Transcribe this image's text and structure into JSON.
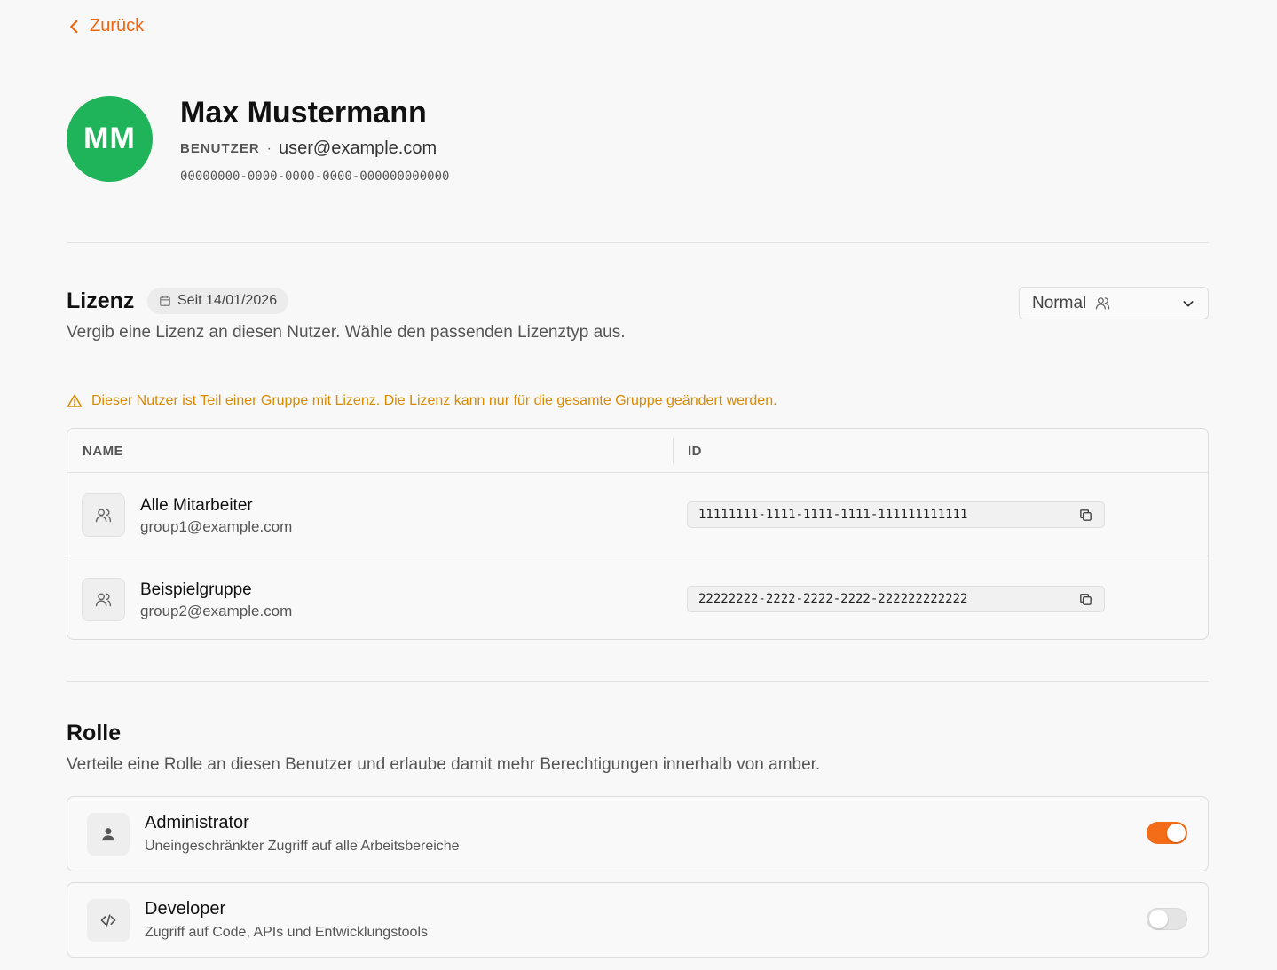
{
  "nav": {
    "back_label": "Zurück"
  },
  "user": {
    "initials": "MM",
    "name": "Max Mustermann",
    "role": "BENUTZER",
    "separator": "·",
    "email": "user@example.com",
    "id": "00000000-0000-0000-0000-000000000000",
    "avatar_color": "#1fb35a"
  },
  "license": {
    "title": "Lizenz",
    "since": "Seit 14/01/2026",
    "description": "Vergib eine Lizenz an diesen Nutzer. Wähle den passenden Lizenztyp aus.",
    "selected": "Normal",
    "warning": "Dieser Nutzer ist Teil einer Gruppe mit Lizenz. Die Lizenz kann nur für die gesamte Gruppe geändert werden.",
    "warning_color": "#d98a00",
    "table": {
      "columns": [
        "NAME",
        "ID"
      ],
      "rows": [
        {
          "name": "Alle Mitarbeiter",
          "email": "group1@example.com",
          "id": "11111111-1111-1111-1111-111111111111"
        },
        {
          "name": "Beispielgruppe",
          "email": "group2@example.com",
          "id": "22222222-2222-2222-2222-222222222222"
        }
      ]
    }
  },
  "roles": {
    "title": "Rolle",
    "description": "Verteile eine Rolle an diesen Benutzer und erlaube damit mehr Berechtigungen innerhalb von amber.",
    "items": [
      {
        "name": "Administrator",
        "description": "Uneingeschränkter Zugriff auf alle Arbeitsbereiche",
        "enabled": true,
        "icon": "person-icon"
      },
      {
        "name": "Developer",
        "description": "Zugriff auf Code, APIs und Entwicklungstools",
        "enabled": false,
        "icon": "code-icon"
      }
    ]
  },
  "accent_color": "#f36c17"
}
